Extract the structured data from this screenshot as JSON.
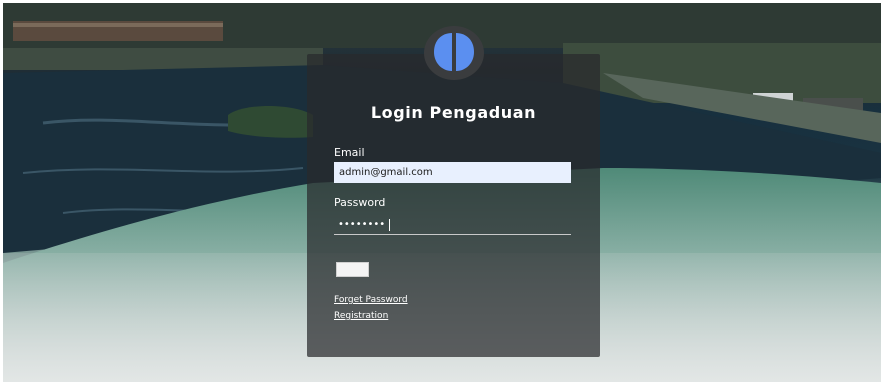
{
  "login": {
    "title": "Login Pengaduan",
    "email_label": "Email",
    "email_value": "admin@gmail.com",
    "password_label": "Password",
    "password_value": "••••••••",
    "links": {
      "forget_password": "Forget Password",
      "registration": "Registration"
    }
  },
  "icons": {
    "logo": "brain-logo-icon"
  },
  "colors": {
    "card_bg": "#282a2c",
    "logo_circle": "#3a3c3e",
    "logo_fill": "#5b8ff0",
    "email_field_bg": "#e8f0fe",
    "text": "#ffffff"
  }
}
